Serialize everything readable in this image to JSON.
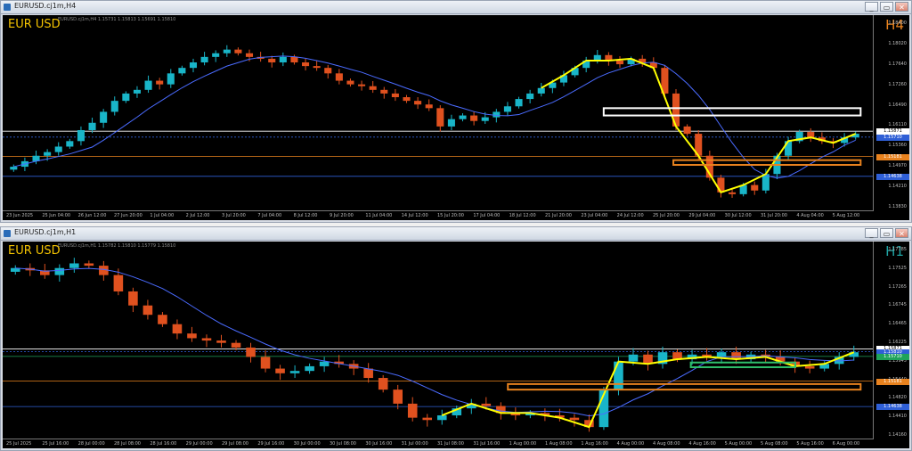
{
  "windows": [
    {
      "title": "EURUSD.cj1m,H4",
      "symbol": "EUR USD",
      "ohlc": "EURUSD.cj1m,H4  1.15731 1.15813 1.15691 1.15810",
      "timeframe": "H4",
      "timeframe_color": "#e8821e",
      "price_ticks": [
        "1.18400",
        "1.18020",
        "1.17640",
        "1.17260",
        "1.16490",
        "1.16110",
        "1.15360",
        "1.14970",
        "1.14210",
        "1.13830"
      ],
      "price_tags": [
        {
          "label": "1.15871",
          "color": "#ffffff",
          "text": "#000000"
        },
        {
          "label": "1.15710",
          "color": "#2f5fd6",
          "text": "#ffffff"
        },
        {
          "label": "1.15181",
          "color": "#e8821e",
          "text": "#ffffff"
        },
        {
          "label": "1.14638",
          "color": "#2f5fd6",
          "text": "#ffffff"
        }
      ],
      "time_ticks": [
        "23 Jun 2025",
        "25 Jun 04:00",
        "26 Jun 12:00",
        "27 Jun 20:00",
        "1 Jul 04:00",
        "2 Jul 12:00",
        "3 Jul 20:00",
        "7 Jul 04:00",
        "8 Jul 12:00",
        "9 Jul 20:00",
        "11 Jul 04:00",
        "14 Jul 12:00",
        "15 Jul 20:00",
        "17 Jul 04:00",
        "18 Jul 12:00",
        "21 Jul 20:00",
        "23 Jul 04:00",
        "24 Jul 12:00",
        "25 Jul 20:00",
        "29 Jul 04:00",
        "30 Jul 12:00",
        "31 Jul 20:00",
        "4 Aug 04:00",
        "5 Aug 12:00"
      ]
    },
    {
      "title": "EURUSD.cj1m,H1",
      "symbol": "EUR USD",
      "ohlc": "EURUSD.cj1m,H1  1.15782 1.15810 1.15779 1.15810",
      "timeframe": "H1",
      "timeframe_color": "#1fa3a3",
      "price_ticks": [
        "1.17785",
        "1.17525",
        "1.17265",
        "1.16745",
        "1.16465",
        "1.16225",
        "1.15945",
        "1.15440",
        "1.14820",
        "1.14410",
        "1.14160"
      ],
      "price_tags": [
        {
          "label": "1.15871",
          "color": "#ffffff",
          "text": "#000000"
        },
        {
          "label": "1.15810",
          "color": "#2f5fd6",
          "text": "#ffffff"
        },
        {
          "label": "1.15710",
          "color": "#1fa35a",
          "text": "#ffffff"
        },
        {
          "label": "1.15181",
          "color": "#e8821e",
          "text": "#ffffff"
        },
        {
          "label": "1.14638",
          "color": "#2f5fd6",
          "text": "#ffffff"
        }
      ],
      "time_ticks": [
        "25 Jul 2025",
        "25 Jul 16:00",
        "28 Jul 00:00",
        "28 Jul 08:00",
        "28 Jul 16:00",
        "29 Jul 00:00",
        "29 Jul 08:00",
        "29 Jul 16:00",
        "30 Jul 00:00",
        "30 Jul 08:00",
        "30 Jul 16:00",
        "31 Jul 00:00",
        "31 Jul 08:00",
        "31 Jul 16:00",
        "1 Aug 00:00",
        "1 Aug 08:00",
        "1 Aug 16:00",
        "4 Aug 00:00",
        "4 Aug 08:00",
        "4 Aug 16:00",
        "5 Aug 00:00",
        "5 Aug 08:00",
        "5 Aug 16:00",
        "6 Aug 00:00"
      ]
    }
  ],
  "window_buttons": {
    "minimize": "_",
    "restore": "▭",
    "close": "✕"
  },
  "colors": {
    "bull": "#19b5c8",
    "bear": "#e0511f",
    "zigzag": "#ffff00",
    "ma": "#4a6bff",
    "white_box": "#ffffff",
    "orange_box": "#e8821e",
    "green_box": "#2fbf6a"
  },
  "chart_data": [
    {
      "type": "candlestick",
      "timeframe": "H4",
      "ylim": [
        1.1383,
        1.187
      ],
      "close_series": [
        1.149,
        1.1505,
        1.152,
        1.153,
        1.1545,
        1.156,
        1.159,
        1.161,
        1.164,
        1.167,
        1.169,
        1.17,
        1.1725,
        1.1715,
        1.1745,
        1.176,
        1.1775,
        1.179,
        1.18,
        1.181,
        1.18,
        1.179,
        1.1785,
        1.1775,
        1.179,
        1.1775,
        1.1765,
        1.176,
        1.1745,
        1.1725,
        1.1715,
        1.171,
        1.17,
        1.169,
        1.168,
        1.167,
        1.166,
        1.165,
        1.16,
        1.162,
        1.163,
        1.1615,
        1.1625,
        1.164,
        1.1655,
        1.1675,
        1.169,
        1.1705,
        1.172,
        1.174,
        1.176,
        1.178,
        1.1795,
        1.178,
        1.177,
        1.1785,
        1.1775,
        1.176,
        1.169,
        1.16,
        1.158,
        1.152,
        1.146,
        1.142,
        1.1415,
        1.144,
        1.1425,
        1.147,
        1.152,
        1.156,
        1.1585,
        1.157,
        1.156,
        1.1555,
        1.157,
        1.158
      ],
      "price_lines": [
        1.15871,
        1.1571,
        1.15181,
        1.14638
      ],
      "zones": [
        {
          "color": "white",
          "from": 1.163,
          "to": 1.165
        },
        {
          "color": "orange",
          "from": 1.1495,
          "to": 1.1508
        }
      ]
    },
    {
      "type": "candlestick",
      "timeframe": "H1",
      "ylim": [
        1.1405,
        1.179
      ],
      "close_series": [
        1.176,
        1.1755,
        1.1745,
        1.176,
        1.177,
        1.1765,
        1.1745,
        1.171,
        1.168,
        1.166,
        1.164,
        1.162,
        1.161,
        1.1605,
        1.16,
        1.159,
        1.157,
        1.1545,
        1.1535,
        1.154,
        1.155,
        1.156,
        1.1555,
        1.1545,
        1.1525,
        1.15,
        1.147,
        1.144,
        1.1435,
        1.1445,
        1.146,
        1.147,
        1.1465,
        1.145,
        1.1445,
        1.145,
        1.1445,
        1.144,
        1.1435,
        1.142,
        1.15,
        1.156,
        1.1575,
        1.1555,
        1.158,
        1.1565,
        1.1575,
        1.157,
        1.158,
        1.1565,
        1.1575,
        1.157,
        1.156,
        1.155,
        1.1545,
        1.1555,
        1.157,
        1.158
      ],
      "price_lines": [
        1.15871,
        1.1581,
        1.1571,
        1.15181,
        1.14638
      ],
      "zones": [
        {
          "color": "green",
          "from": 1.1548,
          "to": 1.1558
        },
        {
          "color": "orange",
          "from": 1.15,
          "to": 1.1512
        }
      ]
    }
  ]
}
